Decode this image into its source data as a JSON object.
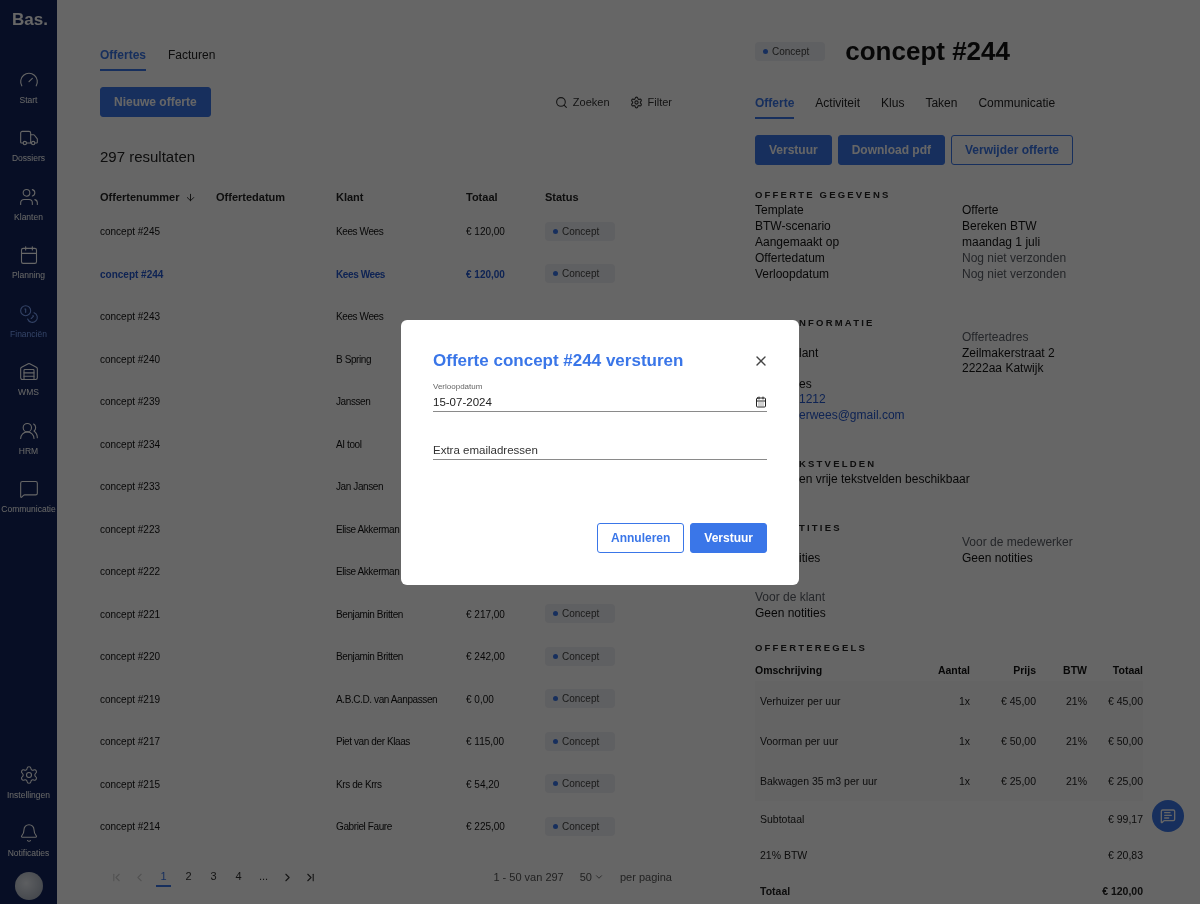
{
  "sidebar": {
    "logo": "Bas.",
    "items": [
      {
        "label": "Start",
        "selected": false
      },
      {
        "label": "Dossiers",
        "selected": false
      },
      {
        "label": "Klanten",
        "selected": false
      },
      {
        "label": "Planning",
        "selected": false
      },
      {
        "label": "Financiën",
        "selected": true
      },
      {
        "label": "WMS",
        "selected": false
      },
      {
        "label": "HRM",
        "selected": false
      },
      {
        "label": "Communicatie",
        "selected": false
      }
    ],
    "bottom_items": [
      {
        "label": "Instellingen"
      },
      {
        "label": "Notificaties"
      }
    ]
  },
  "list": {
    "tabs": [
      {
        "label": "Offertes",
        "selected": true
      },
      {
        "label": "Facturen",
        "selected": false
      }
    ],
    "new_button": "Nieuwe offerte",
    "search": "Zoeken",
    "filter": "Filter",
    "result_count": "297 resultaten",
    "columns": [
      {
        "label": "Offertenummer",
        "sorted": true
      },
      {
        "label": "Offertedatum",
        "sorted": false
      },
      {
        "label": "Klant",
        "sorted": false
      },
      {
        "label": "Totaal",
        "sorted": false
      },
      {
        "label": "Status",
        "sorted": false
      }
    ],
    "rows": [
      {
        "number": "concept #245",
        "client": "Kees Wees",
        "total": "€ 120,00",
        "status": "Concept",
        "selected": false
      },
      {
        "number": "concept #244",
        "client": "Kees Wees",
        "total": "€ 120,00",
        "status": "Concept",
        "selected": true
      },
      {
        "number": "concept #243",
        "client": "Kees Wees",
        "selected": false
      },
      {
        "number": "concept #240",
        "client": "B Spring",
        "selected": false
      },
      {
        "number": "concept #239",
        "client": "Janssen",
        "selected": false
      },
      {
        "number": "concept #234",
        "client": "AI tool",
        "selected": false
      },
      {
        "number": "concept #233",
        "client": "Jan Jansen",
        "selected": false
      },
      {
        "number": "concept #223",
        "client": "Elise Akkerman",
        "selected": false
      },
      {
        "number": "concept #222",
        "client": "Elise Akkerman",
        "selected": false
      },
      {
        "number": "concept #221",
        "client": "Benjamin Britten",
        "total": "€ 217,00",
        "status": "Concept",
        "selected": false
      },
      {
        "number": "concept #220",
        "client": "Benjamin Britten",
        "total": "€ 242,00",
        "status": "Concept",
        "selected": false
      },
      {
        "number": "concept #219",
        "client": "A.B.C.D. van Aanpassen",
        "total": "€ 0,00",
        "status": "Concept",
        "selected": false
      },
      {
        "number": "concept #217",
        "client": "Piet van der Klaas",
        "total": "€ 115,00",
        "status": "Concept",
        "selected": false
      },
      {
        "number": "concept #215",
        "client": "Krs de Krrs",
        "total": "€ 54,20",
        "status": "Concept",
        "selected": false
      },
      {
        "number": "concept #214",
        "client": "Gabriel Faure",
        "total": "€ 225,00",
        "status": "Concept",
        "selected": false
      }
    ],
    "pagination": {
      "pages": [
        {
          "label": "1",
          "selected": true
        },
        {
          "label": "2",
          "selected": false
        },
        {
          "label": "3",
          "selected": false
        },
        {
          "label": "4",
          "selected": false
        },
        {
          "label": "...",
          "selected": false
        }
      ],
      "range": "1 - 50 van 297",
      "page_size": "50",
      "page_size_suffix": "per pagina"
    }
  },
  "detail": {
    "status": "Concept",
    "title": "concept #244",
    "tabs": [
      {
        "label": "Offerte",
        "selected": true
      },
      {
        "label": "Activiteit",
        "selected": false
      },
      {
        "label": "Klus",
        "selected": false
      },
      {
        "label": "Taken",
        "selected": false
      },
      {
        "label": "Communicatie",
        "selected": false
      }
    ],
    "actions": [
      {
        "label": "Verstuur",
        "kind": "primary"
      },
      {
        "label": "Download pdf",
        "kind": "primary"
      },
      {
        "label": "Verwijder offerte",
        "kind": "outline"
      }
    ],
    "details": {
      "heading": "OFFERTE GEGEVENS",
      "rows": [
        {
          "label": "Template",
          "value": "Offerte",
          "muted": false
        },
        {
          "label": "BTW-scenario",
          "value": "Bereken BTW",
          "muted": false
        },
        {
          "label": "Aangemaakt op",
          "value": "maandag 1 juli",
          "muted": false
        },
        {
          "label": "Offertedatum",
          "value": "Nog niet verzonden",
          "muted": true
        },
        {
          "label": "Verloopdatum",
          "value": "Nog niet verzonden",
          "muted": true
        }
      ]
    },
    "customer": {
      "heading": "NFORMATIE",
      "under_dialog": true,
      "rows": [
        {
          "right": {
            "text": "Offerteadres",
            "kind": "label"
          }
        },
        {
          "left": {
            "text": "lant",
            "kind": "text"
          },
          "right": {
            "text": "Zeilmakerstraat 2",
            "kind": "text"
          }
        },
        {
          "right": {
            "text": "2222aa Katwijk",
            "kind": "text"
          }
        },
        {
          "left": {
            "text": "es",
            "kind": "text"
          }
        },
        {
          "left": {
            "text": "1212",
            "kind": "link"
          }
        },
        {
          "left": {
            "text": "erwees@gmail.com",
            "kind": "link"
          }
        }
      ]
    },
    "text_fields": {
      "heading": "KSTVELDEN",
      "under_dialog": true,
      "text": "en vrije tekstvelden beschikbaar"
    },
    "notes": {
      "heading": "TITIES",
      "under_dialog": true,
      "groups": [
        {
          "value": "ities",
          "under_dialog": true
        },
        {
          "label": "Voor de medewerker",
          "value": "Geen notities",
          "under_dialog": false
        },
        {
          "label": "Voor de klant",
          "value": "Geen notities",
          "under_dialog": false
        }
      ]
    },
    "lines": {
      "heading": "OFFERTEREGELS",
      "columns": [
        "Omschrijving",
        "Aantal",
        "Prijs",
        "BTW",
        "Totaal"
      ],
      "rows": [
        {
          "description": "Verhuizer per uur",
          "quantity": "1x",
          "price": "€ 45,00",
          "vat": "21%",
          "total": "€ 45,00"
        },
        {
          "description": "Voorman per uur",
          "quantity": "1x",
          "price": "€ 50,00",
          "vat": "21%",
          "total": "€ 50,00"
        },
        {
          "description": "Bakwagen 35 m3 per uur",
          "quantity": "1x",
          "price": "€ 25,00",
          "vat": "21%",
          "total": "€ 25,00"
        }
      ],
      "totals": [
        {
          "label": "Subtotaal",
          "value": "€ 99,17",
          "kind": "sub"
        },
        {
          "label": "21% BTW",
          "value": "€ 20,83",
          "kind": "sub"
        },
        {
          "label": "Totaal",
          "value": "€ 120,00",
          "kind": "grand"
        }
      ]
    }
  },
  "dialog": {
    "title": "Offerte concept #244 versturen",
    "fields": [
      {
        "kind": "date",
        "label": "Verloopdatum",
        "value": "15-07-2024"
      },
      {
        "kind": "text",
        "placeholder": "Extra emailadressen"
      }
    ],
    "buttons": [
      {
        "label": "Annuleren",
        "kind": "outline"
      },
      {
        "label": "Verstuur",
        "kind": "primary"
      }
    ]
  }
}
